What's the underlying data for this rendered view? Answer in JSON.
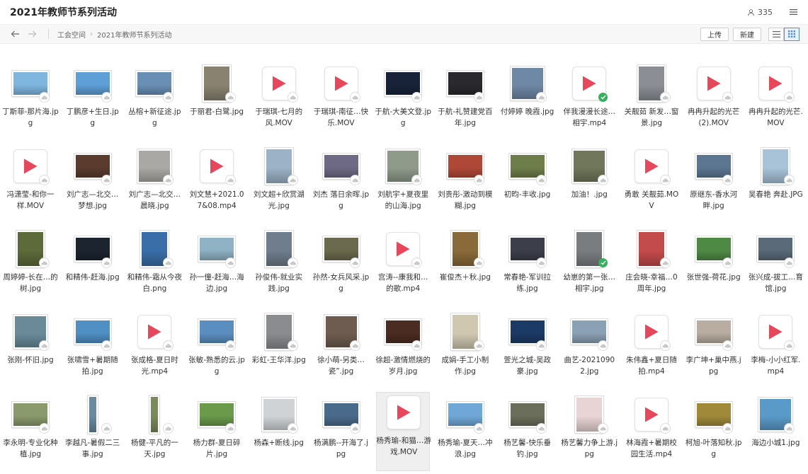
{
  "header": {
    "title": "2021年教师节系列活动",
    "member_count": "335"
  },
  "toolbar": {
    "breadcrumb": [
      "工会空间",
      "2021年教师节系列活动"
    ],
    "upload_label": "上传",
    "new_label": "新建"
  },
  "colors": {
    "accent": "#4a90e2",
    "play": "#e8465a",
    "synced": "#35b15c"
  },
  "files": [
    {
      "name": "丁斯菲-那片海.jpg",
      "kind": "image",
      "status": "cloud",
      "color": "#7fb6e0",
      "shape": "wide"
    },
    {
      "name": "丁鹏彦+生日.jpg",
      "kind": "image",
      "status": "cloud",
      "color": "#5f9fd8",
      "shape": "wide"
    },
    {
      "name": "丛榕+新征途.jpg",
      "kind": "image",
      "status": "cloud",
      "color": "#6a8fb5",
      "shape": "wide"
    },
    {
      "name": "于丽君-白鹭.jpg",
      "kind": "image",
      "status": "cloud",
      "color": "#8a8270",
      "shape": "tall"
    },
    {
      "name": "于瑞琪-七月的风.MOV",
      "kind": "video",
      "status": "cloud"
    },
    {
      "name": "于瑞琪-南征…快乐.MOV",
      "kind": "video",
      "status": "cloud"
    },
    {
      "name": "于航-大美文登.jpg",
      "kind": "image",
      "status": "cloud",
      "color": "#18233a",
      "shape": "wide"
    },
    {
      "name": "于航-礼赞建党百年.jpg",
      "kind": "image",
      "status": "cloud",
      "color": "#2a2a2e",
      "shape": "wide"
    },
    {
      "name": "付婷婷 晚霞.jpg",
      "kind": "image",
      "status": "cloud",
      "color": "#6f88a6",
      "shape": "square"
    },
    {
      "name": "伴我漫漫长途…相宇.mp4",
      "kind": "video",
      "status": "ok"
    },
    {
      "name": "关靓茹 新发…窗景.jpg",
      "kind": "image",
      "status": "cloud",
      "color": "#8b8f95",
      "shape": "tall"
    },
    {
      "name": "冉冉升起的光芒(2).MOV",
      "kind": "video",
      "status": "cloud"
    },
    {
      "name": "冉冉升起的光芒.MOV",
      "kind": "video",
      "status": "cloud"
    },
    {
      "name": "冯潇莹-和你一样.MOV",
      "kind": "video",
      "status": "cloud"
    },
    {
      "name": "刘广志—北交…梦想.jpg",
      "kind": "image",
      "status": "cloud",
      "color": "#5a3b2e",
      "shape": "wide"
    },
    {
      "name": "刘广志—北交…晨晓.jpg",
      "kind": "image",
      "status": "cloud",
      "color": "#a9a8a4",
      "shape": "square"
    },
    {
      "name": "刘文慧+2021.07&08.mp4",
      "kind": "video",
      "status": "cloud"
    },
    {
      "name": "刘文超+欣赏湖光.jpg",
      "kind": "image",
      "status": "cloud",
      "color": "#9cb3c7",
      "shape": "tall"
    },
    {
      "name": "刘杰 落日余晖.jpg",
      "kind": "image",
      "status": "cloud",
      "color": "#6e6a86",
      "shape": "wide"
    },
    {
      "name": "刘航宇+夏夜里的山海.jpg",
      "kind": "image",
      "status": "cloud",
      "color": "#8e9a8a",
      "shape": "square"
    },
    {
      "name": "刘贵彤-激动到模糊.jpg",
      "kind": "image",
      "status": "cloud",
      "color": "#b04838",
      "shape": "wide"
    },
    {
      "name": "初昀-丰收.jpg",
      "kind": "image",
      "status": "cloud",
      "color": "#6e7e4a",
      "shape": "wide"
    },
    {
      "name": "加油！.jpg",
      "kind": "image",
      "status": "cloud",
      "color": "#70775a",
      "shape": "square"
    },
    {
      "name": "勇敢 关靓茹.MOV",
      "kind": "video",
      "status": "cloud"
    },
    {
      "name": "原继东-香水河畔.jpg",
      "kind": "image",
      "status": "cloud",
      "color": "#5c7691",
      "shape": "wide"
    },
    {
      "name": "吴春艳 奔赴.JPG",
      "kind": "image",
      "status": "cloud",
      "color": "#a8c2d8",
      "shape": "tall"
    },
    {
      "name": "周婷婷-长在…的树.jpg",
      "kind": "image",
      "status": "cloud",
      "color": "#5d6a3a",
      "shape": "tall"
    },
    {
      "name": "和精伟-赶海.jpg",
      "kind": "image",
      "status": "cloud",
      "color": "#1c2430",
      "shape": "wide"
    },
    {
      "name": "和精伟-霜从今夜白.png",
      "kind": "image",
      "status": "cloud",
      "color": "#3a6ea8",
      "shape": "tall"
    },
    {
      "name": "孙一僮-赶海…海边.jpg",
      "kind": "image",
      "status": "cloud",
      "color": "#8fb2c4",
      "shape": "wide"
    },
    {
      "name": "孙俊伟-就业实践.jpg",
      "kind": "image",
      "status": "cloud",
      "color": "#6f7d8c",
      "shape": "tall"
    },
    {
      "name": "孙然-女兵风采.jpg",
      "kind": "image",
      "status": "cloud",
      "color": "#6b6a4e",
      "shape": "wide"
    },
    {
      "name": "宫涛--康我和…的歌.mp4",
      "kind": "video",
      "status": "cloud"
    },
    {
      "name": "崔俊杰＋秋.jpg",
      "kind": "image",
      "status": "cloud",
      "color": "#8a6a3a",
      "shape": "tall"
    },
    {
      "name": "常春艳-军训拉练.jpg",
      "kind": "image",
      "status": "cloud",
      "color": "#3c3f4a",
      "shape": "wide"
    },
    {
      "name": "幼崽的第一张…相宇.jpg",
      "kind": "image",
      "status": "ok",
      "color": "#7a7d80",
      "shape": "tall"
    },
    {
      "name": "庄会晓-幸福…0周年.jpg",
      "kind": "image",
      "status": "cloud",
      "color": "#c44b4b",
      "shape": "tall"
    },
    {
      "name": "张世强-荷花.jpg",
      "kind": "image",
      "status": "cloud",
      "color": "#4f8a45",
      "shape": "wide"
    },
    {
      "name": "张兴成-拔工…育馆.jpg",
      "kind": "image",
      "status": "cloud",
      "color": "#5a6a78",
      "shape": "wide"
    },
    {
      "name": "张刚-怀旧.jpg",
      "kind": "image",
      "status": "cloud",
      "color": "#6a8a9a",
      "shape": "square"
    },
    {
      "name": "张啸雪+暑期随拍.jpg",
      "kind": "image",
      "status": "cloud",
      "color": "#4f8fc4",
      "shape": "wide"
    },
    {
      "name": "张成格-夏日时光.mp4",
      "kind": "video",
      "status": "cloud"
    },
    {
      "name": "张敏-熟悉的云.jpg",
      "kind": "image",
      "status": "cloud",
      "color": "#5b8ec0",
      "shape": "wide"
    },
    {
      "name": "彩虹-王华洋.jpg",
      "kind": "image",
      "status": "cloud",
      "color": "#8a8c90",
      "shape": "tall"
    },
    {
      "name": "徐小萌-另类…瓷”.jpg",
      "kind": "image",
      "status": "cloud",
      "color": "#6e5c50",
      "shape": "square"
    },
    {
      "name": "徐超-激情燃烧的岁月.jpg",
      "kind": "image",
      "status": "cloud",
      "color": "#4a2c22",
      "shape": "wide"
    },
    {
      "name": "成娟-手工小制作.jpg",
      "kind": "image",
      "status": "cloud",
      "color": "#cfc7b0",
      "shape": "tall"
    },
    {
      "name": "萱光之城-吴政豪.jpg",
      "kind": "image",
      "status": "cloud",
      "color": "#1c3a66",
      "shape": "wide"
    },
    {
      "name": "曲艺-20210902.jpg",
      "kind": "image",
      "status": "cloud",
      "color": "#8aa0b4",
      "shape": "wide"
    },
    {
      "name": "朱伟鑫+夏日随拍.mp4",
      "kind": "video",
      "status": "cloud"
    },
    {
      "name": "李广坤+巢中燕.jpg",
      "kind": "image",
      "status": "cloud",
      "color": "#b8ada0",
      "shape": "wide"
    },
    {
      "name": "李梅-小小红军.mp4",
      "kind": "video",
      "status": "cloud"
    },
    {
      "name": "李永明-专业化种植.jpg",
      "kind": "image",
      "status": "cloud",
      "color": "#8a9a6c",
      "shape": "wide"
    },
    {
      "name": "李越凡-暑假二三事.jpg",
      "kind": "image",
      "status": "cloud",
      "color": "#6a8aa0",
      "shape": "strip"
    },
    {
      "name": "杨健-平凡的一天.jpg",
      "kind": "image",
      "status": "cloud",
      "color": "#7a8a5a",
      "shape": "strip"
    },
    {
      "name": "杨力群-夏日碎片.jpg",
      "kind": "image",
      "status": "cloud",
      "color": "#6a9a4a",
      "shape": "wide"
    },
    {
      "name": "杨森+断线.jpg",
      "kind": "image",
      "status": "cloud",
      "color": "#cfd3d6",
      "shape": "square"
    },
    {
      "name": "杨满鹏--开海了.jpg",
      "kind": "image",
      "status": "cloud",
      "color": "#4a6a8c",
      "shape": "wide"
    },
    {
      "name": "杨秀瑜-和猫…游戏.MOV",
      "kind": "video",
      "status": "none",
      "selected": true
    },
    {
      "name": "杨秀瑜-夏天…冲浪.jpg",
      "kind": "image",
      "status": "cloud",
      "color": "#6fa8d8",
      "shape": "wide"
    },
    {
      "name": "杨艺馨-快乐垂钓.jpg",
      "kind": "image",
      "status": "cloud",
      "color": "#6a6e5a",
      "shape": "wide"
    },
    {
      "name": "杨艺馨力争上游.jpg",
      "kind": "image",
      "status": "cloud",
      "color": "#e8d4d4",
      "shape": "tall"
    },
    {
      "name": "林海霞+暑期校园生活.mp4",
      "kind": "video",
      "status": "cloud"
    },
    {
      "name": "柯旭-叶落知秋.jpg",
      "kind": "image",
      "status": "cloud",
      "color": "#a08a3a",
      "shape": "wide"
    },
    {
      "name": "海边小城1.jpg",
      "kind": "image",
      "status": "cloud",
      "color": "#5a9ac8",
      "shape": "square"
    }
  ]
}
